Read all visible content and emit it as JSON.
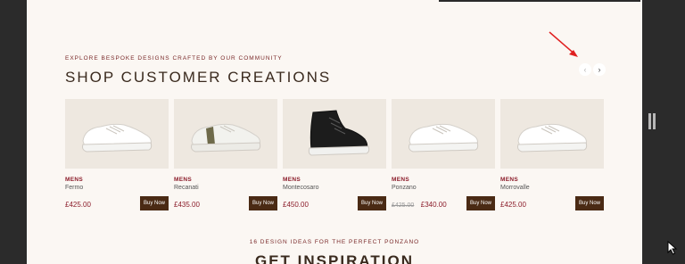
{
  "section": {
    "eyebrow": "EXPLORE BESPOKE DESIGNS CRAFTED BY OUR COMMUNITY",
    "title": "SHOP CUSTOMER CREATIONS"
  },
  "nav": {
    "prev_icon": "‹",
    "next_icon": "›"
  },
  "products": [
    {
      "category": "MENS",
      "name": "Fermo",
      "price": "£425.00",
      "old_price": "",
      "buy_label": "Buy Now",
      "shoe": "white-low"
    },
    {
      "category": "MENS",
      "name": "Recanati",
      "price": "£435.00",
      "old_price": "",
      "buy_label": "Buy Now",
      "shoe": "white-olive-low"
    },
    {
      "category": "MENS",
      "name": "Montecosaro",
      "price": "£450.00",
      "old_price": "",
      "buy_label": "Buy Now",
      "shoe": "black-high"
    },
    {
      "category": "MENS",
      "name": "Ponzano",
      "price": "£340.00",
      "old_price": "£425.00",
      "buy_label": "Buy Now",
      "shoe": "white-low"
    },
    {
      "category": "MENS",
      "name": "Morrovalle",
      "price": "£425.00",
      "old_price": "",
      "buy_label": "Buy Now",
      "shoe": "white-low"
    }
  ],
  "inspiration": {
    "eyebrow": "16 DESIGN IDEAS FOR THE PERFECT PONZANO",
    "title": "GET INSPIRATION"
  },
  "colors": {
    "accent": "#8b1c2a",
    "button": "#4a2a14",
    "background": "#fbf7f3",
    "annotation": "#e02020"
  }
}
